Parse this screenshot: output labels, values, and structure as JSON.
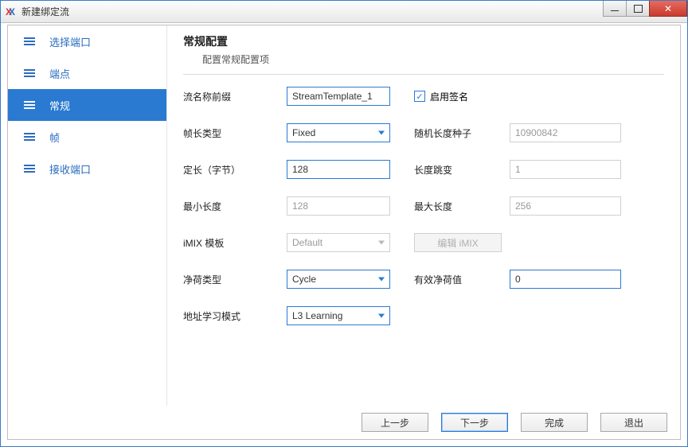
{
  "window": {
    "title": "新建绑定流"
  },
  "sidebar": {
    "items": [
      {
        "label": "选择端口"
      },
      {
        "label": "端点"
      },
      {
        "label": "常规"
      },
      {
        "label": "帧"
      },
      {
        "label": "接收端口"
      }
    ]
  },
  "header": {
    "title": "常规配置",
    "subtitle": "配置常规配置项"
  },
  "labels": {
    "stream_prefix": "流名称前缀",
    "enable_sign": "启用签名",
    "frame_len_type": "帧长类型",
    "rand_seed": "随机长度种子",
    "fixed_len": "定长（字节）",
    "len_hop": "长度跳变",
    "min_len": "最小长度",
    "max_len": "最大长度",
    "imix_tmpl": "iMIX 模板",
    "edit_imix": "编辑 iMIX",
    "payload_type": "净荷类型",
    "valid_payload": "有效净荷值",
    "addr_learn": "地址学习模式"
  },
  "values": {
    "stream_prefix": "StreamTemplate_1",
    "enable_sign_checked": true,
    "frame_len_type": "Fixed",
    "rand_seed": "10900842",
    "fixed_len": "128",
    "len_hop": "1",
    "min_len": "128",
    "max_len": "256",
    "imix_tmpl": "Default",
    "payload_type": "Cycle",
    "valid_payload": "0",
    "addr_learn": "L3 Learning"
  },
  "footer": {
    "back": "上一步",
    "next": "下一步",
    "finish": "完成",
    "exit": "退出"
  }
}
